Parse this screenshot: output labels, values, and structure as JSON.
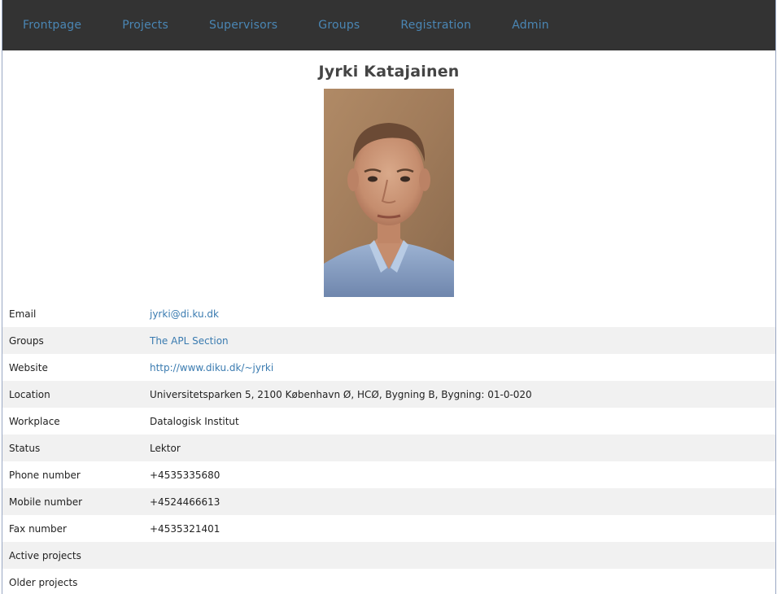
{
  "nav": {
    "items": [
      {
        "label": "Frontpage"
      },
      {
        "label": "Projects"
      },
      {
        "label": "Supervisors"
      },
      {
        "label": "Groups"
      },
      {
        "label": "Registration"
      },
      {
        "label": "Admin"
      }
    ]
  },
  "profile": {
    "name": "Jyrki Katajainen",
    "photo_icon": "portrait-photo"
  },
  "details": {
    "email": {
      "label": "Email",
      "value": "jyrki@di.ku.dk"
    },
    "groups": {
      "label": "Groups",
      "value": "The APL Section"
    },
    "website": {
      "label": "Website",
      "value": "http://www.diku.dk/~jyrki"
    },
    "location": {
      "label": "Location",
      "value": "Universitetsparken 5, 2100 København Ø, HCØ, Bygning B, Bygning: 01-0-020"
    },
    "workplace": {
      "label": "Workplace",
      "value": "Datalogisk Institut"
    },
    "status": {
      "label": "Status",
      "value": "Lektor"
    },
    "phone": {
      "label": "Phone number",
      "value": "+4535335680"
    },
    "mobile": {
      "label": "Mobile number",
      "value": "+4524466613"
    },
    "fax": {
      "label": "Fax number",
      "value": "+4535321401"
    },
    "active_projects": {
      "label": "Active projects",
      "value": ""
    },
    "older_projects": {
      "label": "Older projects",
      "value": ""
    }
  },
  "colors": {
    "navbar_bg": "#333333",
    "link": "#3a7bb0",
    "row_alt": "#f1f1f1"
  }
}
